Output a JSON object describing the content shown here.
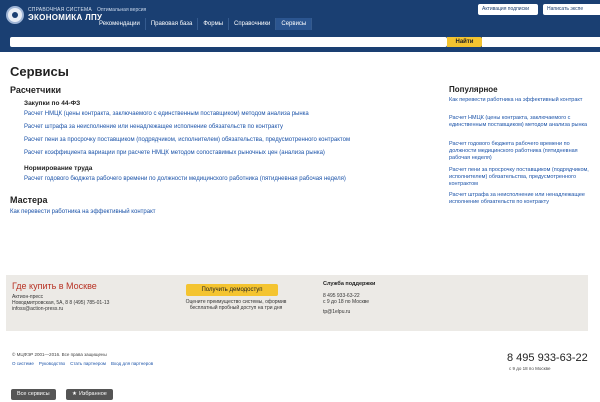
{
  "header": {
    "brand_top": "СПРАВОЧНАЯ СИСТЕМА",
    "brand_main": "ЭКОНОМИКА ЛПУ",
    "version_label": "Оптимальная версия",
    "activate_label": "Активация подписки",
    "write_label": "Написать экспе",
    "tabs": [
      {
        "label": "Рекомендации"
      },
      {
        "label": "Правовая база"
      },
      {
        "label": "Формы"
      },
      {
        "label": "Справочники"
      },
      {
        "label": "Сервисы"
      }
    ],
    "search_button": "Найти"
  },
  "main": {
    "title": "Сервисы",
    "calculators_title": "Расчетчики",
    "procurement_title": "Закупки по 44-ФЗ",
    "procurement_links": [
      "Расчет НМЦК (цены контракта, заключаемого с единственным поставщиком) методом анализа рынка",
      "Расчет штрафа за неисполнение или ненадлежащее исполнение обязательств по контракту",
      "Расчет пени за просрочку поставщиком (подрядчиком, исполнителем) обязательства, предусмотренного контрактом",
      "Расчет коэффициента вариации при расчете НМЦК методом сопоставимых рыночных цен (анализа рынка)"
    ],
    "labor_title": "Нормирование труда",
    "labor_links": [
      "Расчет годового бюджета рабочего времени по должности медицинского работника (пятидневная рабочая неделя)"
    ],
    "masters_title": "Мастера",
    "masters_links": [
      "Как перевести работника на эффективный контракт"
    ]
  },
  "sidebar": {
    "title": "Популярное",
    "links": [
      "Как перевести работника на эффективный контракт",
      "Расчет НМЦК (цены контракта, заключаемого с единственным поставщиком) методом анализа рынка",
      "Расчет годового бюджета рабочего времени по должности медицинского работника (пятидневная рабочая неделя)",
      "Расчет пени за просрочку поставщиком (подрядчиком, исполнителем) обязательства, предусмотренного контрактом",
      "Расчет штрафа за неисполнение или ненадлежащее исполнение обязательств по контракту"
    ]
  },
  "footer": {
    "where_title": "Где купить в Москве",
    "company": "Актион-пресс",
    "address": "Новодмитровская, 5А, 8  8 (495) 785-01-13",
    "email": "infoss@action-press.ru",
    "demo_button": "Получить демодоступ",
    "demo_text": "Оцените преимущество системы, оформив бесплатный пробный доступ на три дня",
    "support_title": "Служба поддержки",
    "support_phone": "8 495 933-63-22",
    "support_hours": "с 9 до 18 по Москве",
    "support_email": "tp@1elpu.ru",
    "copyright": "© МЦФЭР 2001—2016. Все права защищены",
    "bottom_links": [
      "О системе",
      "Руководство",
      "Стать партнером",
      "Вход для партнеров"
    ],
    "big_phone": "8 495 933-63-22",
    "big_hours": "с 9 до 18 по Москве"
  },
  "bottom_bar": {
    "all_services": "Все сервисы",
    "favorites": "Избранное"
  },
  "colors": {
    "header_bg": "#1a3f72",
    "accent_yellow": "#f4c430",
    "link": "#1a52a8",
    "footer_title": "#b83224"
  }
}
